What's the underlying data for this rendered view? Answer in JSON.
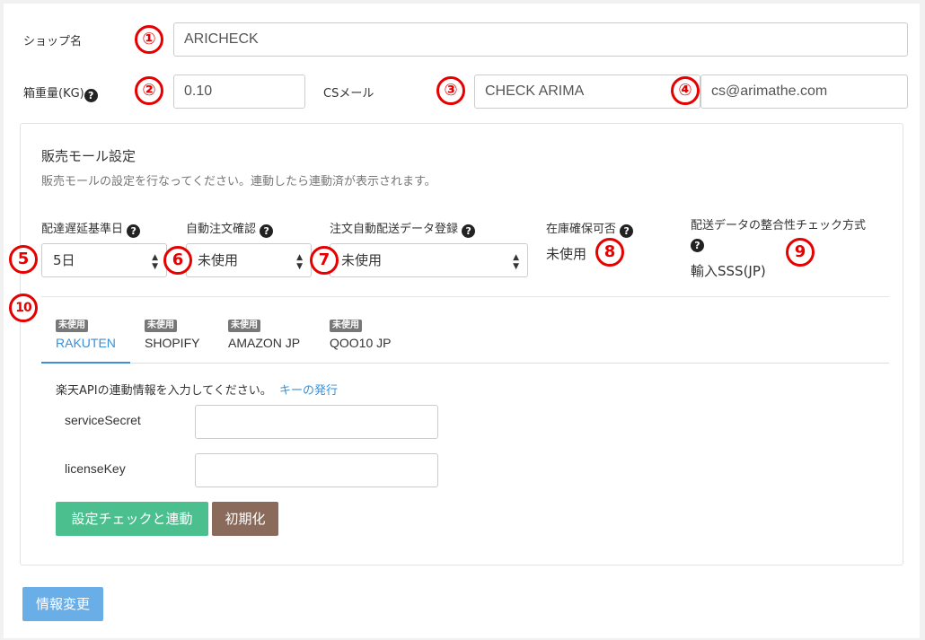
{
  "shop": {
    "label": "ショップ名",
    "value": "ARICHECK"
  },
  "box_weight": {
    "label": "箱重量(KG)",
    "value": "0.10"
  },
  "cs_mail": {
    "label": "CSメール",
    "name_value": "CHECK ARIMA",
    "email_value": "cs@arimathe.com"
  },
  "mall_settings": {
    "title": "販売モール設定",
    "description": "販売モールの設定を行なってください。連動したら連動済が表示されます。",
    "fields": [
      {
        "label": "配達遅延基準日",
        "value": "5日"
      },
      {
        "label": "自動注文確認",
        "value": "未使用"
      },
      {
        "label": "注文自動配送データ登録",
        "value": "未使用"
      },
      {
        "label": "在庫確保可否",
        "value": "未使用"
      },
      {
        "label": "配送データの整合性チェック方式",
        "value": "輸入SSS(JP)"
      }
    ]
  },
  "tabs": [
    {
      "badge": "未使用",
      "name": "RAKUTEN"
    },
    {
      "badge": "未使用",
      "name": "SHOPIFY"
    },
    {
      "badge": "未使用",
      "name": "AMAZON JP"
    },
    {
      "badge": "未使用",
      "name": "QOO10 JP"
    }
  ],
  "api": {
    "info_text": "楽天APIの連動情報を入力してください。",
    "key_link": "キーの発行",
    "service_secret_label": "serviceSecret",
    "service_secret_value": "",
    "license_key_label": "licenseKey",
    "license_key_value": ""
  },
  "buttons": {
    "check_link": "設定チェックと連動",
    "reset": "初期化",
    "update": "情報変更"
  },
  "annotations": [
    "①",
    "②",
    "③",
    "④",
    "5",
    "6",
    "7",
    "8",
    "9",
    "10"
  ],
  "help_icon": "?",
  "colors": {
    "annotation": "#e60000",
    "link": "#3a8fd8",
    "green_button": "#4cbf8f",
    "brown_button": "#8a6a5b",
    "blue_button": "#6aaee8"
  }
}
